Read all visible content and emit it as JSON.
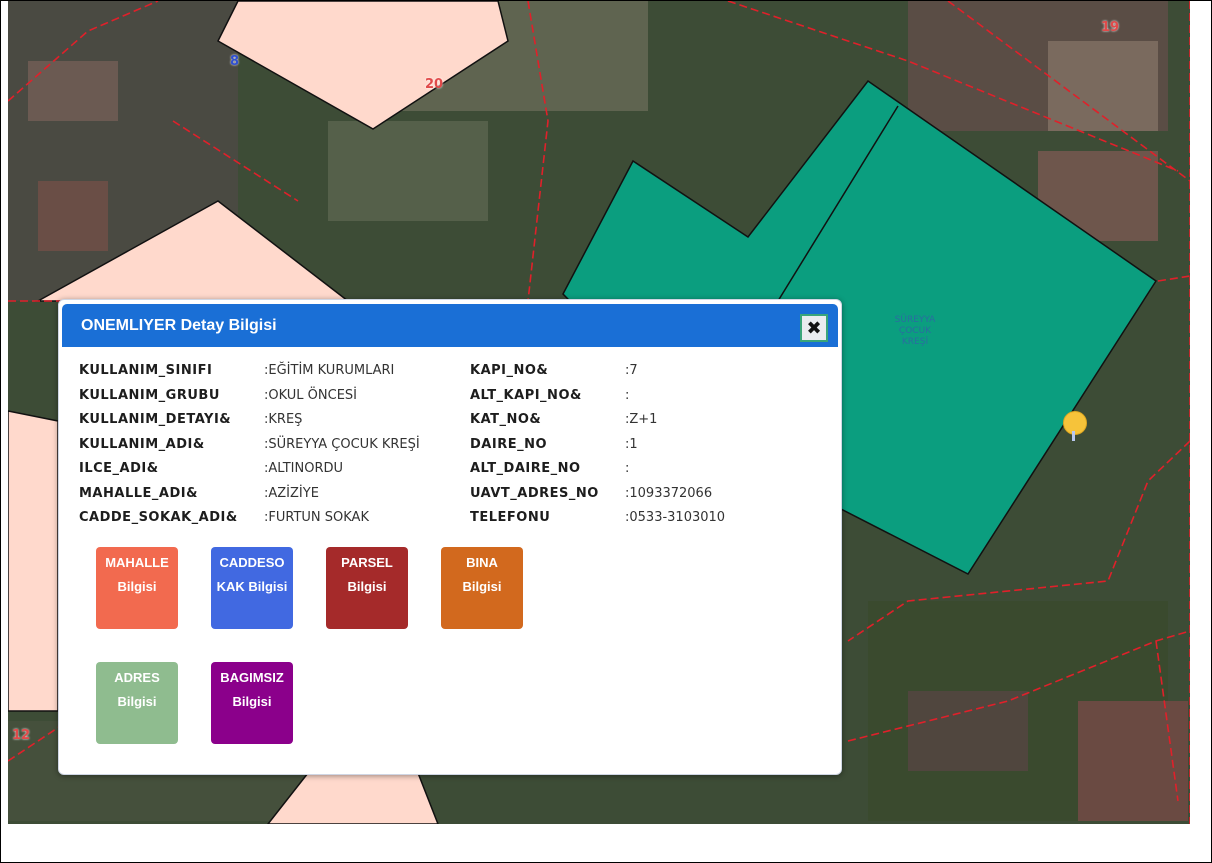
{
  "map": {
    "parcel_numbers": [
      "8",
      "20",
      "19",
      "12"
    ],
    "building_label": [
      "SÜREYYA",
      "ÇOCUK",
      "KREŞİ"
    ]
  },
  "popup": {
    "title": "ONEMLIYER Detay Bilgisi",
    "close_icon": "close-icon",
    "left_fields": [
      {
        "key": "KULLANIM_SINIFI",
        "value": ":EĞİTİM KURUMLARI"
      },
      {
        "key": "KULLANIM_GRUBU",
        "value": ":OKUL ÖNCESİ"
      },
      {
        "key": "KULLANIM_DETAYI&",
        "value": ":KREŞ"
      },
      {
        "key": "KULLANIM_ADI&",
        "value": ":SÜREYYA ÇOCUK KREŞİ"
      },
      {
        "key": "ILCE_ADI&",
        "value": ":ALTINORDU"
      },
      {
        "key": "MAHALLE_ADI&",
        "value": ":AZİZİYE"
      },
      {
        "key": "CADDE_SOKAK_ADI&",
        "value": ":FURTUN SOKAK"
      }
    ],
    "right_fields": [
      {
        "key": "KAPI_NO&",
        "value": ":7"
      },
      {
        "key": "ALT_KAPI_NO&",
        "value": ":"
      },
      {
        "key": "KAT_NO&",
        "value": ":Z+1"
      },
      {
        "key": "DAIRE_NO",
        "value": ":1"
      },
      {
        "key": "ALT_DAIRE_NO",
        "value": ":"
      },
      {
        "key": "UAVT_ADRES_NO",
        "value": ":1093372066"
      },
      {
        "key": "TELEFONU",
        "value": ":0533-3103010"
      }
    ],
    "buttons": [
      {
        "line1": "MAHALLE",
        "line2": "Bilgisi",
        "color": "#f26a4f"
      },
      {
        "line1": "CADDESO",
        "line2": "KAK Bilgisi",
        "color": "#4169e1"
      },
      {
        "line1": "PARSEL",
        "line2": "Bilgisi",
        "color": "#a52a2a"
      },
      {
        "line1": "BINA",
        "line2": "Bilgisi",
        "color": "#d2691e"
      },
      {
        "line1": "ADRES",
        "line2": "Bilgisi",
        "color": "#8fbc8f"
      },
      {
        "line1": "BAGIMSIZ",
        "line2": "Bilgisi",
        "color": "#8b008b"
      }
    ]
  },
  "colors": {
    "header": "#1a6fd6",
    "parcel_fill": "#ffd9cc",
    "building_fill": "#0b9e7f",
    "parcel_border": "#e0202a"
  }
}
